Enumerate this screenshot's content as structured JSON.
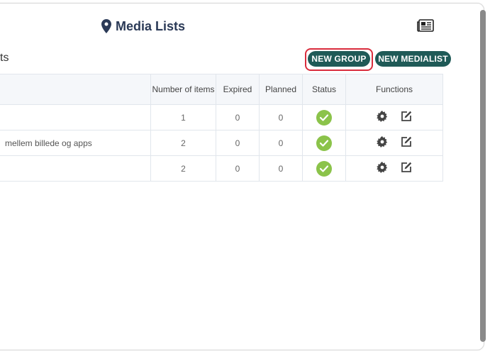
{
  "header": {
    "title": "Media Lists",
    "title_icon": "map-marker-icon",
    "right_icon": "newspaper-icon"
  },
  "section": {
    "title_fragment": "ts"
  },
  "toolbar": {
    "new_group_label": "NEW GROUP",
    "new_medialist_label": "NEW MEDIALIST"
  },
  "table": {
    "headers": {
      "name": "",
      "items": "Number of items",
      "expired": "Expired",
      "planned": "Planned",
      "status": "Status",
      "functions": "Functions"
    },
    "rows": [
      {
        "name": "",
        "items": "1",
        "expired": "0",
        "planned": "0",
        "status": "active"
      },
      {
        "name": "mellem billede og apps",
        "items": "2",
        "expired": "0",
        "planned": "0",
        "status": "active"
      },
      {
        "name": "",
        "items": "2",
        "expired": "0",
        "planned": "0",
        "status": "active"
      }
    ]
  },
  "colors": {
    "button_bg": "#1f5a57",
    "highlight": "#d92c3c",
    "status_ok": "#8bc34a",
    "title": "#2b3a57"
  }
}
